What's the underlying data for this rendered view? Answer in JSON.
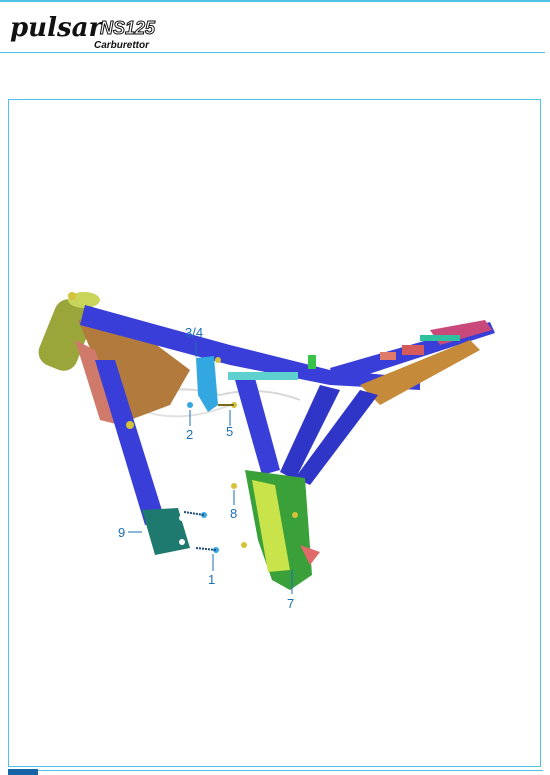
{
  "brand": {
    "logo_text": "pulsar",
    "model": "NS125",
    "variant": "Carburettor"
  },
  "callouts": {
    "c34": "3/4",
    "c2": "2",
    "c5": "5",
    "c8": "8",
    "c9": "9",
    "c1": "1",
    "c7": "7"
  },
  "colors": {
    "accent_line": "#4fc3e6",
    "callout_text": "#1b6fb4",
    "frame_main": "#3a3ed8",
    "footer_bar": "#1565a7"
  }
}
